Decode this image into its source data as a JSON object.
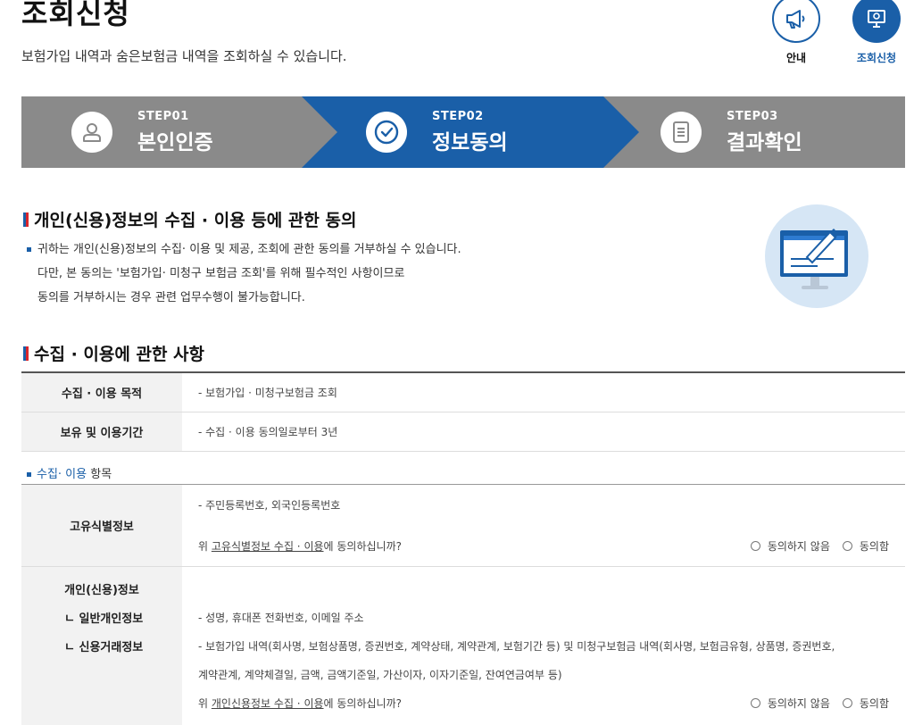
{
  "header": {
    "title": "조회신청",
    "description": "보험가입 내역과 숨은보험금 내역을 조회하실 수 있습니다.",
    "guide_label": "안내",
    "inquiry_label": "조회신청"
  },
  "steps": [
    {
      "num": "STEP01",
      "label": "본인인증",
      "state": "done"
    },
    {
      "num": "STEP02",
      "label": "정보동의",
      "state": "active"
    },
    {
      "num": "STEP03",
      "label": "결과확인",
      "state": "pending"
    }
  ],
  "colors": {
    "active": "#1a5fa8",
    "inactive": "#8a8a8a",
    "accent_red": "#d9262c"
  },
  "consent_section": {
    "title": "개인(신용)정보의 수집 · 이용 등에 관한 동의",
    "notice_line1": "귀하는 개인(신용)정보의 수집· 이용 및 제공, 조회에 관한 동의를 거부하실 수 있습니다.",
    "notice_line2": "다만, 본 동의는 '보험가입· 미청구 보험금 조회'를 위해 필수적인 사항이므로",
    "notice_line3": "동의를 거부하시는 경우 관련 업무수행이 불가능합니다."
  },
  "usage_section": {
    "title": "수집 · 이용에 관한 사항",
    "rows": [
      {
        "label": "수집 · 이용 목적",
        "value": "- 보험가입 · 미청구보험금 조회"
      },
      {
        "label": "보유 및 이용기간",
        "value": "- 수집 · 이용 동의일로부터 3년"
      }
    ],
    "items_title_blue": "수집· 이용",
    "items_title_rest": " 항목"
  },
  "unique_id": {
    "label": "고유식별정보",
    "value": "- 주민등록번호, 외국인등록번호",
    "question_prefix": "위 ",
    "question_link": "고유식별정보 수집 · 이용",
    "question_suffix": "에 동의하십니까?",
    "disagree": "동의하지 않음",
    "agree": "동의함"
  },
  "personal_info": {
    "label": "개인(신용)정보",
    "sub1": "ㄴ 일반개인정보",
    "sub2": "ㄴ 신용거래정보",
    "value1": "- 성명, 휴대폰 전화번호, 이메일 주소",
    "value2a": "- 보험가입 내역(회사명, 보험상품명, 증권번호, 계약상태, 계약관계, 보험기간 등) 및 미청구보험금 내역(회사명, 보험금유형, 상품명, 증권번호,",
    "value2b": "계약관계, 계약체결일, 금액, 금액기준일, 가산이자, 이자기준일, 잔여연금여부 등)",
    "question_prefix": "위 ",
    "question_link": "개인신용정보 수집 · 이용",
    "question_suffix": "에 동의하십니까?",
    "disagree": "동의하지 않음",
    "agree": "동의함"
  }
}
